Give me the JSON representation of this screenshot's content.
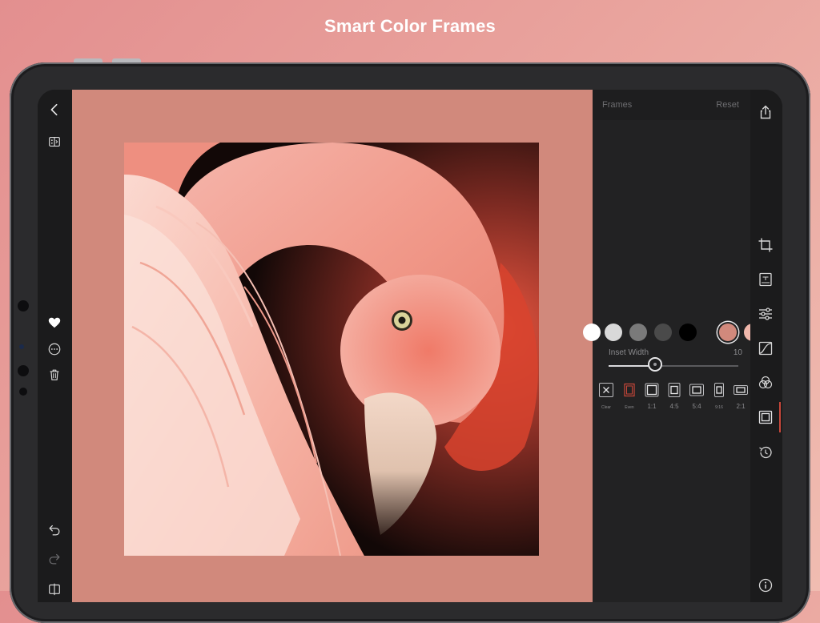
{
  "headline": "Smart Color Frames",
  "panel": {
    "title": "Frames",
    "reset_label": "Reset",
    "swatches": [
      "#ffffff",
      "#d9d9d9",
      "#7a7a7a",
      "#4a4a4a",
      "#000000",
      "#d1897c",
      "#f0b7ab"
    ],
    "selected_swatch": 5,
    "inset_label": "Inset Width",
    "inset_value": "10",
    "ratios": [
      {
        "label": "Clear"
      },
      {
        "label": "Even"
      },
      {
        "label": "1:1"
      },
      {
        "label": "4:5"
      },
      {
        "label": "5:4"
      },
      {
        "label": "9:16"
      },
      {
        "label": "2:1"
      }
    ]
  },
  "colors": {
    "frame": "#d1897c",
    "accent": "#c8473a"
  },
  "icons": {
    "left": [
      "back-icon",
      "compare-icon",
      "heart-icon",
      "more-icon",
      "trash-icon",
      "undo-icon",
      "redo-icon",
      "split-view-icon"
    ],
    "right": [
      "share-icon",
      "crop-icon",
      "text-icon",
      "adjust-icon",
      "curves-icon",
      "color-mix-icon",
      "frame-icon",
      "history-icon",
      "info-icon"
    ]
  }
}
